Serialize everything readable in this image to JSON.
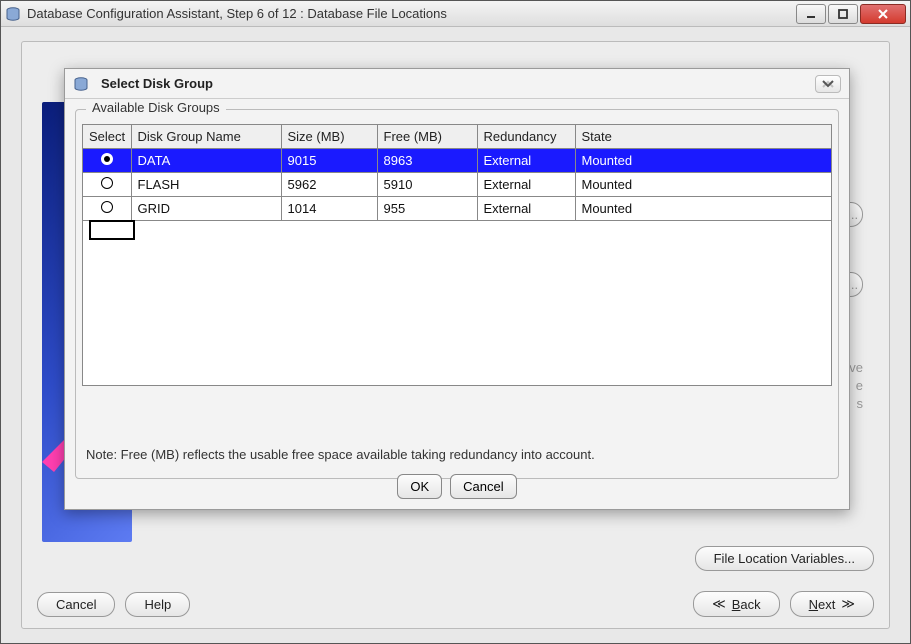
{
  "outerWindow": {
    "title": "Database Configuration Assistant, Step 6 of 12 : Database File Locations"
  },
  "wizard": {
    "buttons": {
      "cancel": "Cancel",
      "help": "Help",
      "back": "Back",
      "next": "Next",
      "fileLocationVars": "File Location Variables..."
    },
    "hiddenBg": {
      "b1": "e...",
      "b2": "e...",
      "t1": "ove",
      "t2": "e",
      "t3": "s"
    }
  },
  "modal": {
    "title": "Select Disk Group",
    "groupLabel": "Available Disk Groups",
    "columns": [
      "Select",
      "Disk Group Name",
      "Size (MB)",
      "Free (MB)",
      "Redundancy",
      "State"
    ],
    "rows": [
      {
        "selected": true,
        "name": "DATA",
        "size": "9015",
        "free": "8963",
        "redundancy": "External",
        "state": "Mounted"
      },
      {
        "selected": false,
        "name": "FLASH",
        "size": "5962",
        "free": "5910",
        "redundancy": "External",
        "state": "Mounted"
      },
      {
        "selected": false,
        "name": "GRID",
        "size": "1014",
        "free": "955",
        "redundancy": "External",
        "state": "Mounted"
      }
    ],
    "note": "Note:  Free (MB) reflects the usable free space available taking redundancy into account.",
    "buttons": {
      "ok": "OK",
      "cancel": "Cancel"
    }
  }
}
